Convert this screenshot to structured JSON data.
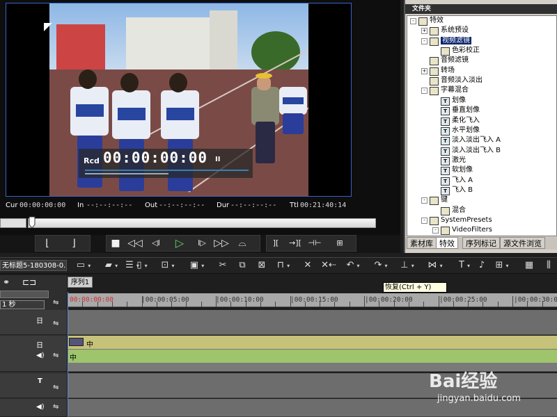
{
  "player": {
    "rcd_label": "Rcd",
    "rcd_time": "00:00:00:00",
    "pause_glyph": "II",
    "cur_label": "Cur",
    "cur_value": "00:00:00:00",
    "in_label": "In",
    "in_value": "--:--:--:--",
    "out_label": "Out",
    "out_value": "--:--:--:--",
    "dur_label": "Dur",
    "dur_value": "--:--:--:--",
    "ttl_label": "Ttl",
    "ttl_value": "00:21:40:14"
  },
  "transport": {
    "mark_in": "mark-in-icon",
    "mark_out": "mark-out-icon",
    "stop": "■",
    "rewind": "◁◁",
    "step_back": "◁I",
    "play": "▷",
    "step_fwd": "I▷",
    "fast_fwd": "▷▷",
    "loop": "loop-icon"
  },
  "effects_panel": {
    "header": "文件夹",
    "tree": [
      {
        "label": "特效",
        "level": 0,
        "icon": "folder",
        "expander": "-"
      },
      {
        "label": "系统预设",
        "level": 1,
        "icon": "folder",
        "expander": "+"
      },
      {
        "label": "视频滤镜",
        "level": 1,
        "icon": "folder",
        "expander": "-",
        "selected": true
      },
      {
        "label": "色彩校正",
        "level": 2,
        "icon": "folder",
        "expander": ""
      },
      {
        "label": "音频滤镜",
        "level": 1,
        "icon": "folder",
        "expander": ""
      },
      {
        "label": "转场",
        "level": 1,
        "icon": "folder",
        "expander": "+"
      },
      {
        "label": "音频淡入淡出",
        "level": 1,
        "icon": "folder",
        "expander": ""
      },
      {
        "label": "字幕混合",
        "level": 1,
        "icon": "folder",
        "expander": "-"
      },
      {
        "label": "划像",
        "level": 2,
        "icon": "T",
        "expander": ""
      },
      {
        "label": "垂直划像",
        "level": 2,
        "icon": "T",
        "expander": ""
      },
      {
        "label": "柔化飞入",
        "level": 2,
        "icon": "T",
        "expander": ""
      },
      {
        "label": "水平划像",
        "level": 2,
        "icon": "T",
        "expander": ""
      },
      {
        "label": "淡入淡出飞入 A",
        "level": 2,
        "icon": "T",
        "expander": ""
      },
      {
        "label": "淡入淡出飞入 B",
        "level": 2,
        "icon": "T",
        "expander": ""
      },
      {
        "label": "激光",
        "level": 2,
        "icon": "T",
        "expander": ""
      },
      {
        "label": "软划像",
        "level": 2,
        "icon": "T",
        "expander": ""
      },
      {
        "label": "飞入 A",
        "level": 2,
        "icon": "T",
        "expander": ""
      },
      {
        "label": "飞入 B",
        "level": 2,
        "icon": "T",
        "expander": ""
      },
      {
        "label": "键",
        "level": 1,
        "icon": "folder",
        "expander": "-"
      },
      {
        "label": "混合",
        "level": 2,
        "icon": "folder",
        "expander": ""
      },
      {
        "label": "SystemPresets",
        "level": 1,
        "icon": "folder",
        "expander": "-"
      },
      {
        "label": "VideoFilters",
        "level": 2,
        "icon": "folder",
        "expander": "-"
      }
    ],
    "tabs": [
      "素材库",
      "特效",
      "序列标记",
      "源文件浏览"
    ]
  },
  "toolbar": {
    "project_name": "无标题5-180308-0...",
    "tooltip": "恢复(Ctrl + Y)"
  },
  "timeline": {
    "sequence_tab": "序列1",
    "scale": "1 秒",
    "ticks": [
      "00:00:00:00",
      "|00:00:05:00",
      "|00:00:10:00",
      "|00:00:15:00",
      "|00:00:20:00",
      "|00:00:25:00",
      "|00:00:30:00"
    ],
    "video_clip_label": "中",
    "audio_clip_label": "中",
    "track_icons": {
      "v1": "日",
      "va": "日",
      "t": "T"
    }
  },
  "watermark": {
    "text": "Bai经验",
    "url": "jingyan.baidu.com"
  },
  "colors": {
    "accent_blue": "#3b64c8",
    "play_green": "#5fd35f",
    "clip_video": "#c7c27a",
    "clip_audio": "#9ec46c",
    "tree_selected": "#0a246a"
  }
}
